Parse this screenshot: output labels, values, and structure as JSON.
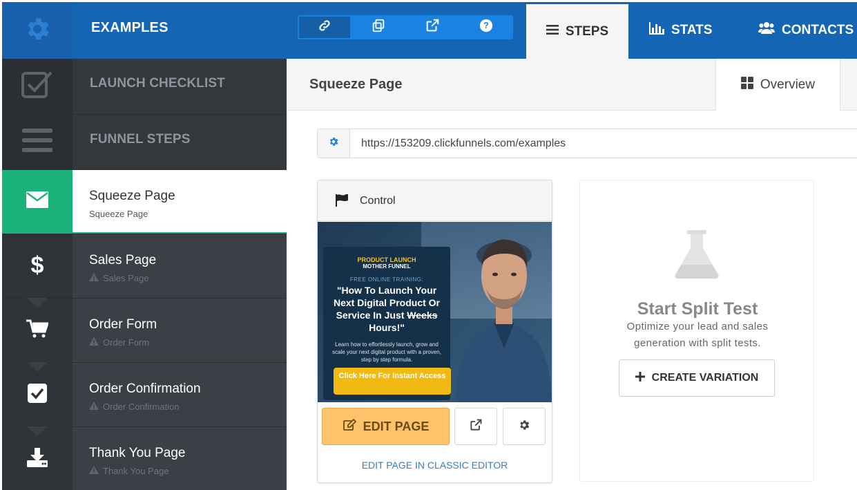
{
  "app": {
    "title": "EXAMPLES",
    "logo_icon": "gear-icon"
  },
  "toolbar": {
    "icons": [
      "link-icon",
      "copy-icon",
      "external-link-icon",
      "help-icon"
    ],
    "active_index": 0
  },
  "nav": {
    "tabs": [
      {
        "label": "STEPS",
        "icon": "menu-icon",
        "active": true
      },
      {
        "label": "STATS",
        "icon": "bar-chart-icon",
        "active": false
      },
      {
        "label": "CONTACTS",
        "icon": "users-icon",
        "active": false
      }
    ]
  },
  "sidebar": {
    "launch_checklist": "LAUNCH CHECKLIST",
    "funnel_steps": "FUNNEL STEPS",
    "steps": [
      {
        "title": "Squeeze Page",
        "subtitle": "Squeeze Page",
        "icon": "envelope-icon",
        "active": true
      },
      {
        "title": "Sales Page",
        "subtitle": "Sales Page",
        "icon": "dollar-icon",
        "active": false
      },
      {
        "title": "Order Form",
        "subtitle": "Order Form",
        "icon": "cart-icon",
        "active": false
      },
      {
        "title": "Order Confirmation",
        "subtitle": "Order Confirmation",
        "icon": "checkbox-icon",
        "active": false
      },
      {
        "title": "Thank You Page",
        "subtitle": "Thank You Page",
        "icon": "download-icon",
        "active": false
      }
    ]
  },
  "main": {
    "page_title": "Squeeze Page",
    "overview_tab": "Overview",
    "url": "https://153209.clickfunnels.com/examples"
  },
  "control": {
    "label": "Control",
    "preview": {
      "brand_line1": "PRODUCT LAUNCH",
      "brand_line2": "MOTHER FUNNEL",
      "pre_headline": "FREE ONLINE TRAINING:",
      "headline_part1": "\"How To Launch Your Next Digital Product Or Service In Just ",
      "headline_strike": "Weeks",
      "headline_part2": " Hours!\"",
      "subtext": "Learn how to effortlessly launch, grow and scale your next digital product with a proven, step by step formula.",
      "cta": "Click Here For Instant Access"
    },
    "edit_button": "EDIT PAGE",
    "classic_link": "EDIT PAGE IN CLASSIC EDITOR"
  },
  "split_test": {
    "title": "Start Split Test",
    "description": "Optimize your lead and sales generation with split tests.",
    "create_button": "CREATE VARIATION"
  },
  "colors": {
    "brand_blue": "#1565b5",
    "toolbar_blue": "#1a82e0",
    "sidebar_dark": "#3b4046",
    "active_green": "#18b27a",
    "edit_orange": "#fcc36b",
    "link_blue": "#3b7bbf"
  }
}
